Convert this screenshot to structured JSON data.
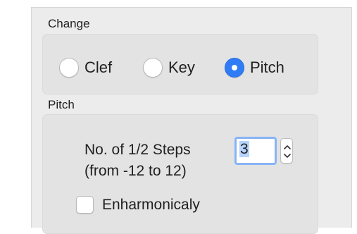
{
  "change_section": {
    "title": "Change",
    "options": [
      {
        "label": "Clef",
        "selected": false
      },
      {
        "label": "Key",
        "selected": false
      },
      {
        "label": "Pitch",
        "selected": true
      }
    ]
  },
  "pitch_section": {
    "title": "Pitch",
    "steps_label_line1": "No. of 1/2 Steps",
    "steps_label_line2": "(from -12 to 12)",
    "steps_value": "3",
    "enharmonic_label": "Enharmonicaly",
    "enharmonic_checked": false
  },
  "colors": {
    "accent": "#2f7cf6",
    "focus_ring": "#88b4f7",
    "panel_bg": "#ececec",
    "group_bg": "#e3e3e3"
  },
  "icons": {
    "stepper": "up-down-chevron-icon"
  }
}
